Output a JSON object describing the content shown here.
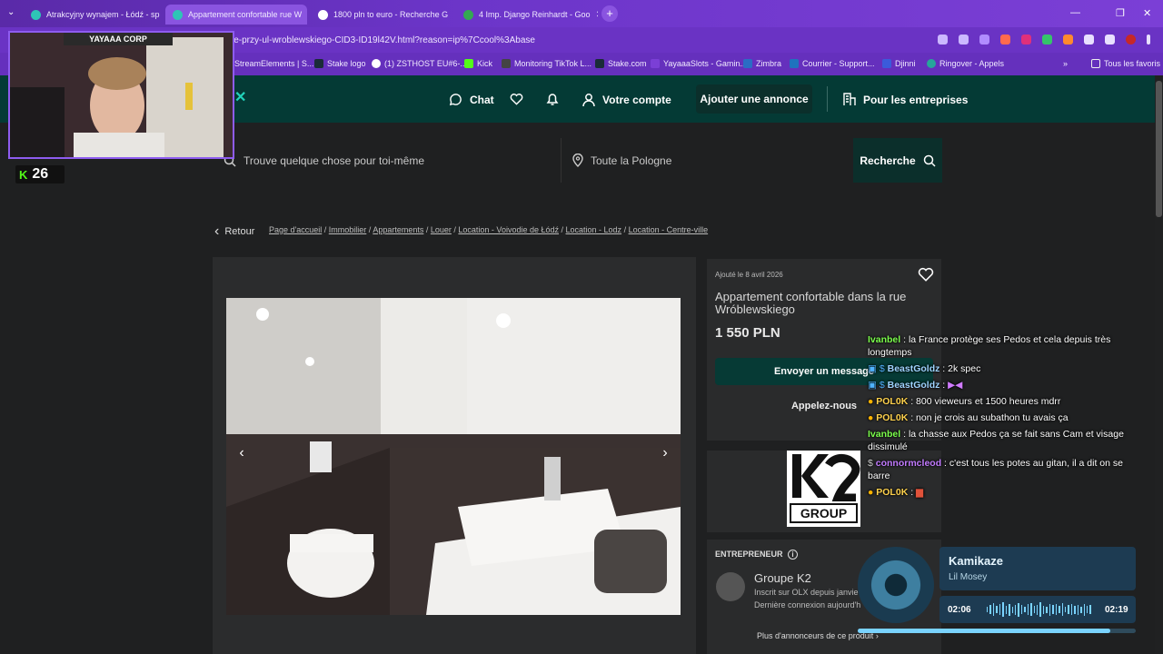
{
  "browser": {
    "tabs": [
      {
        "title": "Atrakcyjny wynajem - Łódź - sp",
        "color": "#2ec4b6"
      },
      {
        "title": "Appartement confortable rue W",
        "color": "#2ec4b6"
      },
      {
        "title": "1800 pln to euro - Recherche G",
        "color": "#ffffff"
      },
      {
        "title": "4 Imp. Django Reinhardt - Goo",
        "color": "#34a853"
      }
    ],
    "url": "ie-przy-ul-wroblewskiego-CID3-ID19l42V.html?reason=ip%7Ccool%3Abase",
    "bookmarks": [
      {
        "label": "StreamElements | S...",
        "color": "#4c7cff"
      },
      {
        "label": "Stake logo",
        "color": "#1a2c38"
      },
      {
        "label": "(1) ZSTHOST EU#6-...",
        "color": "#ffffff"
      },
      {
        "label": "Kick",
        "color": "#53fc18"
      },
      {
        "label": "Monitoring TikTok L...",
        "color": "#444444"
      },
      {
        "label": "Stake.com",
        "color": "#1a2c38"
      },
      {
        "label": "YayaaaSlots - Gamin...",
        "color": "#7b3fd6"
      },
      {
        "label": "Zimbra",
        "color": "#2b6cc4"
      },
      {
        "label": "Courrier - Support...",
        "color": "#1e73be"
      },
      {
        "label": "Djinni",
        "color": "#3b5bdb"
      },
      {
        "label": "Ringover - Appels",
        "color": "#26a69a"
      }
    ],
    "all_bookmarks": "Tous les favoris",
    "more": "»"
  },
  "olx": {
    "nav": {
      "chat": "Chat",
      "account": "Votre compte",
      "add": "Ajouter une annonce",
      "business": "Pour les entreprises"
    },
    "search": {
      "placeholder": "Trouve quelque chose pour toi-même",
      "location": "Toute la Pologne",
      "button": "Recherche"
    },
    "back": "Retour",
    "breadcrumbs": [
      "Page d'accueil",
      "Immobilier",
      "Appartements",
      "Louer",
      "Location - Voivodie de Łódź",
      "Location - Lodz",
      "Location - Centre-ville"
    ],
    "listing": {
      "added": "Ajouté le 8 avril 2026",
      "title": "Appartement confortable dans la rue Wróblewskiego",
      "price": "1 550 PLN",
      "message_btn": "Envoyer un message",
      "call_btn": "Appelez-nous"
    },
    "agency": {
      "logo_text": "GROUP",
      "label": "ENTREPRENEUR",
      "name": "Groupe K2",
      "since": "Inscrit sur OLX depuis janvie",
      "last_seen": "Dernière connexion aujourd'h",
      "more": "Plus d'annonceurs de ce produit"
    }
  },
  "stream": {
    "cam_label": "YAYAAA CORP",
    "kick_count": "26",
    "chat": [
      {
        "user": "Ivanbel",
        "color": "#7cff4d",
        "text": "la France protège ses Pedos et cela depuis très longtemps"
      },
      {
        "user": "BeastGoldz",
        "color": "#9fd4ff",
        "text": "2k spec"
      },
      {
        "user": "BeastGoldz",
        "color": "#9fd4ff",
        "text": ""
      },
      {
        "user": "POL0K",
        "color": "#ffd24d",
        "text": "800 vieweurs et 1500 heures mdrr"
      },
      {
        "user": "POL0K",
        "color": "#ffd24d",
        "text": "non je crois au subathon tu avais ça"
      },
      {
        "user": "Ivanbel",
        "color": "#7cff4d",
        "text": "la chasse aux Pedos ça se fait sans Cam et visage dissimulé"
      },
      {
        "user": "connormcleod",
        "color": "#c27bff",
        "text": "c'est tous les potes au gitan, il a dit on se barre"
      },
      {
        "user": "POL0K",
        "color": "#ffd24d",
        "text": ""
      }
    ],
    "music": {
      "song": "Kamikaze",
      "artist": "Lil Mosey",
      "elapsed": "02:06",
      "total": "02:19",
      "progress": 0.91
    }
  }
}
